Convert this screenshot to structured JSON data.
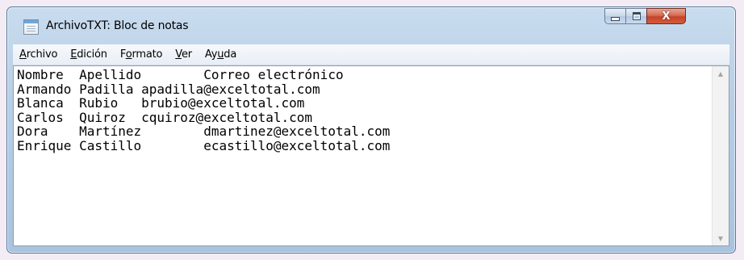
{
  "window": {
    "title": "ArchivoTXT: Bloc de notas",
    "controls": {
      "minimize": "minimize-icon",
      "maximize": "maximize-icon",
      "close": "close-icon"
    }
  },
  "menubar": {
    "items": [
      {
        "accel": "A",
        "rest": "rchivo"
      },
      {
        "accel": "E",
        "rest": "dición"
      },
      {
        "pre": "F",
        "accel": "o",
        "rest": "rmato"
      },
      {
        "accel": "V",
        "rest": "er"
      },
      {
        "pre": "Ay",
        "accel": "u",
        "rest": "da"
      }
    ]
  },
  "editor": {
    "content": "Nombre  Apellido        Correo electrónico\nArmando Padilla apadilla@exceltotal.com\nBlanca  Rubio   brubio@exceltotal.com\nCarlos  Quiroz  cquiroz@exceltotal.com\nDora    Martínez        dmartinez@exceltotal.com\nEnrique Castillo        ecastillo@exceltotal.com"
  },
  "scrollbar": {
    "up_arrow": "▲",
    "down_arrow": "▼"
  },
  "colors": {
    "frame": "#b8cfe6",
    "close_button": "#c5432a",
    "editor_bg": "#ffffff"
  }
}
